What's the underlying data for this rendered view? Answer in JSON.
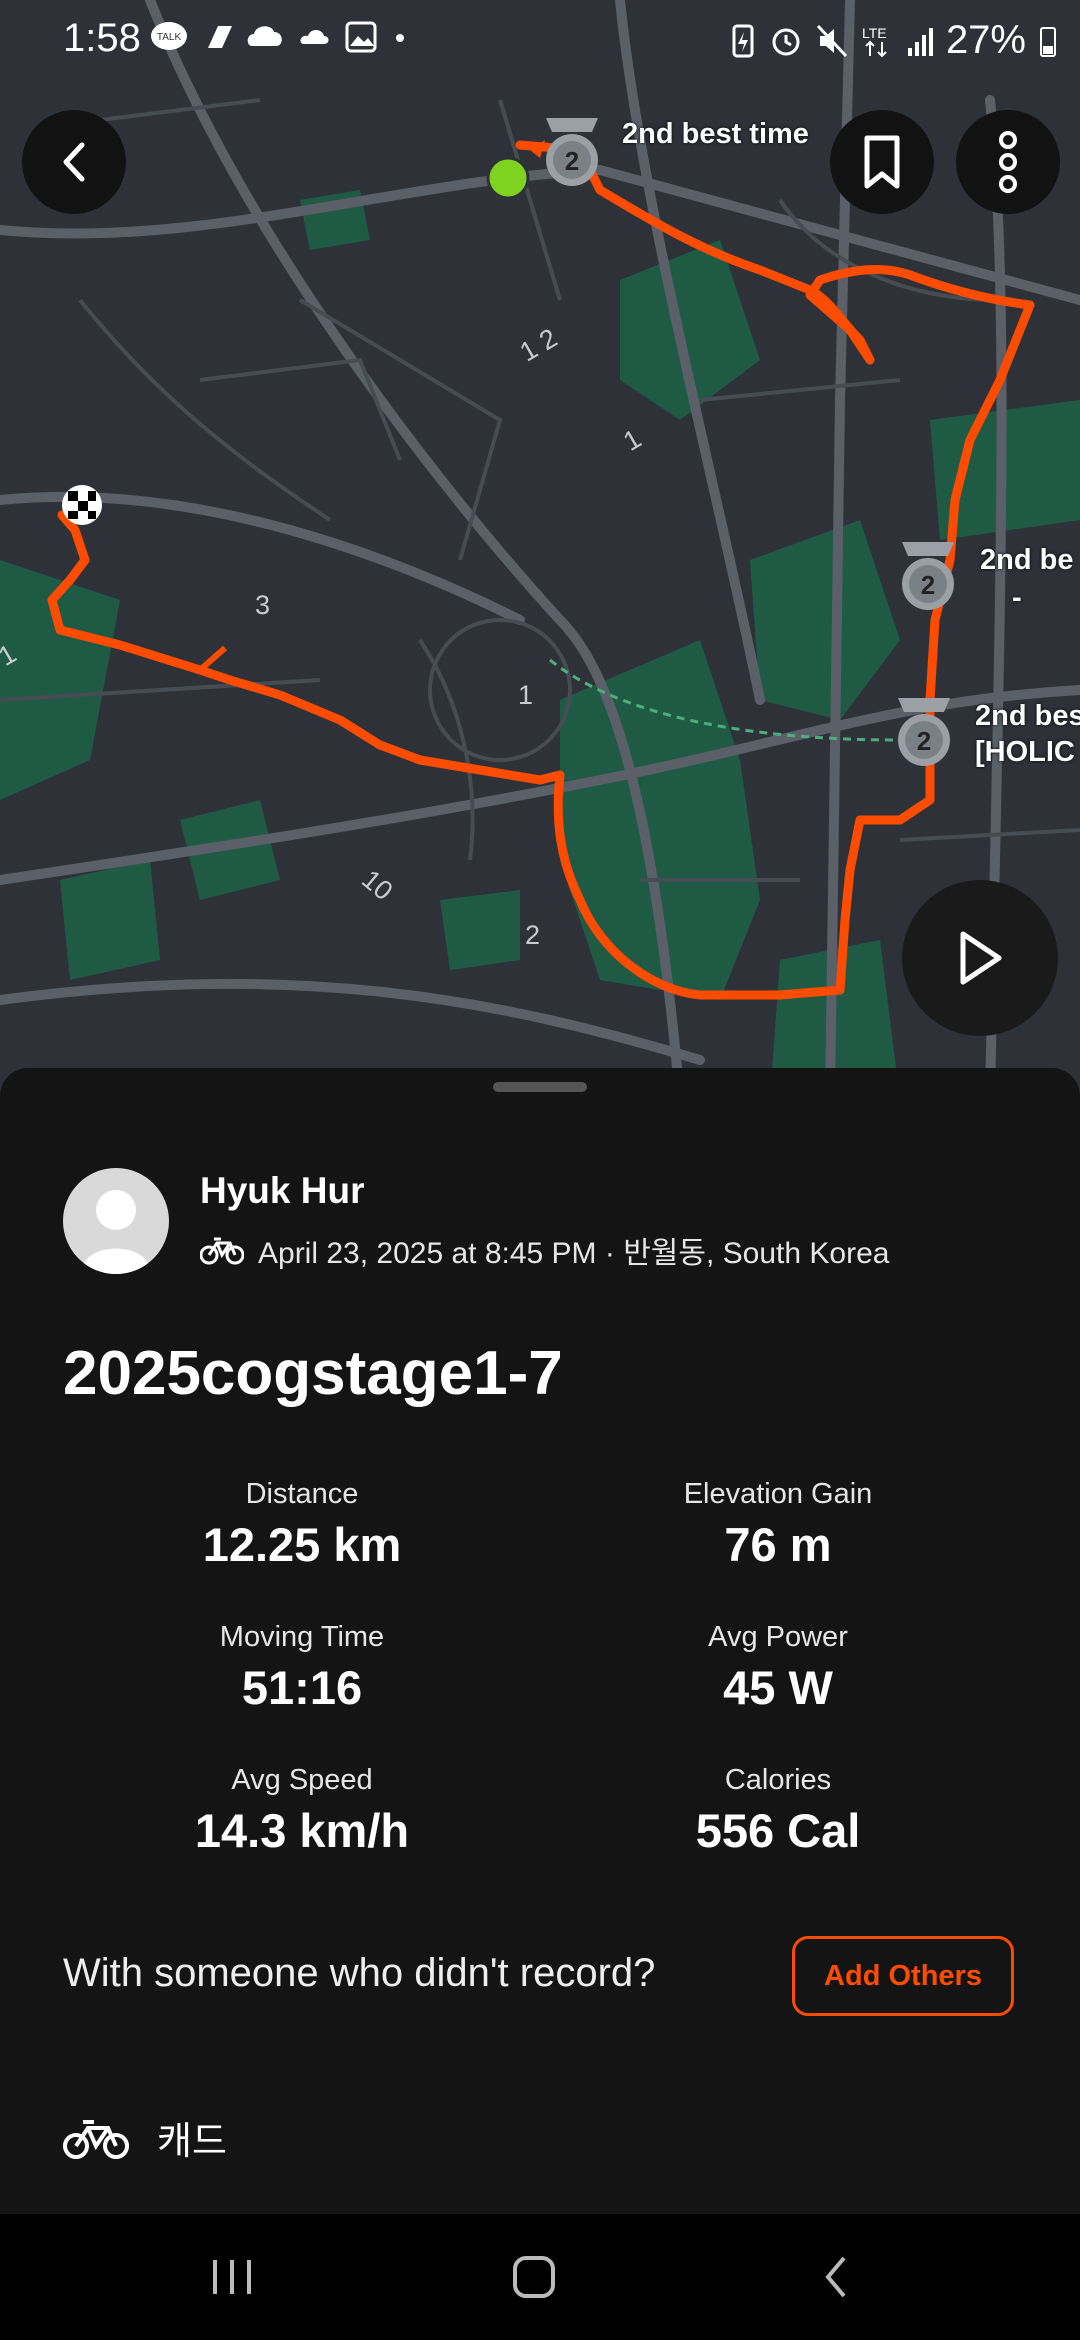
{
  "status_bar": {
    "time": "1:58",
    "notification_icons": [
      "kakaotalk-icon",
      "tag-icon",
      "cloud-icon",
      "weather-icon",
      "gallery-icon",
      "dot-icon"
    ],
    "right_icons": [
      "battery-saver-icon",
      "alarm-icon",
      "mute-icon",
      "lte-icon",
      "signal-icon"
    ],
    "battery": "27%"
  },
  "map": {
    "segment_labels": [
      "2nd best time",
      "2nd be",
      "-",
      "2nd bes",
      "[HOLIC"
    ],
    "road_numbers": [
      "1 2",
      "1",
      "3",
      "1",
      "10",
      "2",
      "1"
    ],
    "route_color": "#fc4c02"
  },
  "header_buttons": {
    "back": "back-arrow-icon",
    "bookmark": "bookmark-icon",
    "more": "more-vertical-icon"
  },
  "activity": {
    "athlete_name": "Hyuk Hur",
    "sport_icon": "bike-icon",
    "meta": "April 23, 2025 at 8:45 PM · 반월동, South Korea",
    "title": "2025cogstage1-7",
    "stats": [
      {
        "label": "Distance",
        "value": "12.25 km"
      },
      {
        "label": "Elevation Gain",
        "value": "76 m"
      },
      {
        "label": "Moving Time",
        "value": "51:16"
      },
      {
        "label": "Avg Power",
        "value": "45 W"
      },
      {
        "label": "Avg Speed",
        "value": "14.3 km/h"
      },
      {
        "label": "Calories",
        "value": "556 Cal"
      }
    ],
    "with_others_prompt": "With someone who didn't record?",
    "add_others_label": "Add Others",
    "gear_name": "캐드"
  },
  "colors": {
    "accent": "#fc4c02",
    "background": "#141414",
    "map_base": "#2e3238",
    "park": "#1f5a45"
  }
}
